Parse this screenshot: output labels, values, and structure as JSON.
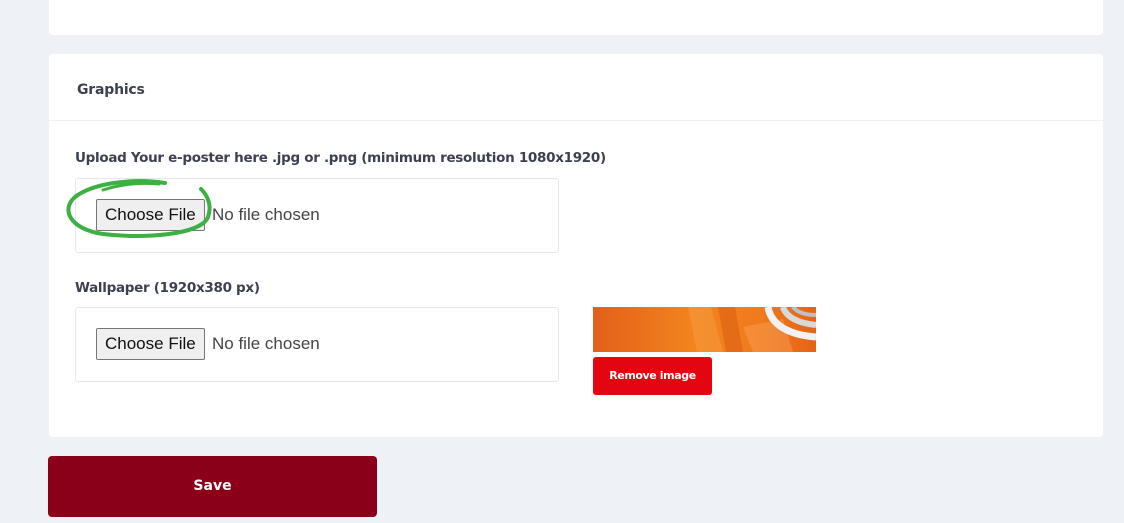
{
  "graphics_section": {
    "title": "Graphics"
  },
  "poster_upload": {
    "label": "Upload Your e-poster here .jpg or .png (minimum resolution 1080x1920)",
    "button_label": "Choose File",
    "status": "No file chosen",
    "highlighted": true,
    "highlight_color": "#3cb043"
  },
  "wallpaper_upload": {
    "label": "Wallpaper (1920x380 px)",
    "button_label": "Choose File",
    "status": "No file chosen",
    "remove_label": "Remove image"
  },
  "actions": {
    "save_label": "Save"
  },
  "colors": {
    "page_background": "#eef2f7",
    "card_background": "#ffffff",
    "remove_button": "#e3050f",
    "save_button": "#8b0018",
    "wallpaper_orange": "#f07a1c"
  }
}
